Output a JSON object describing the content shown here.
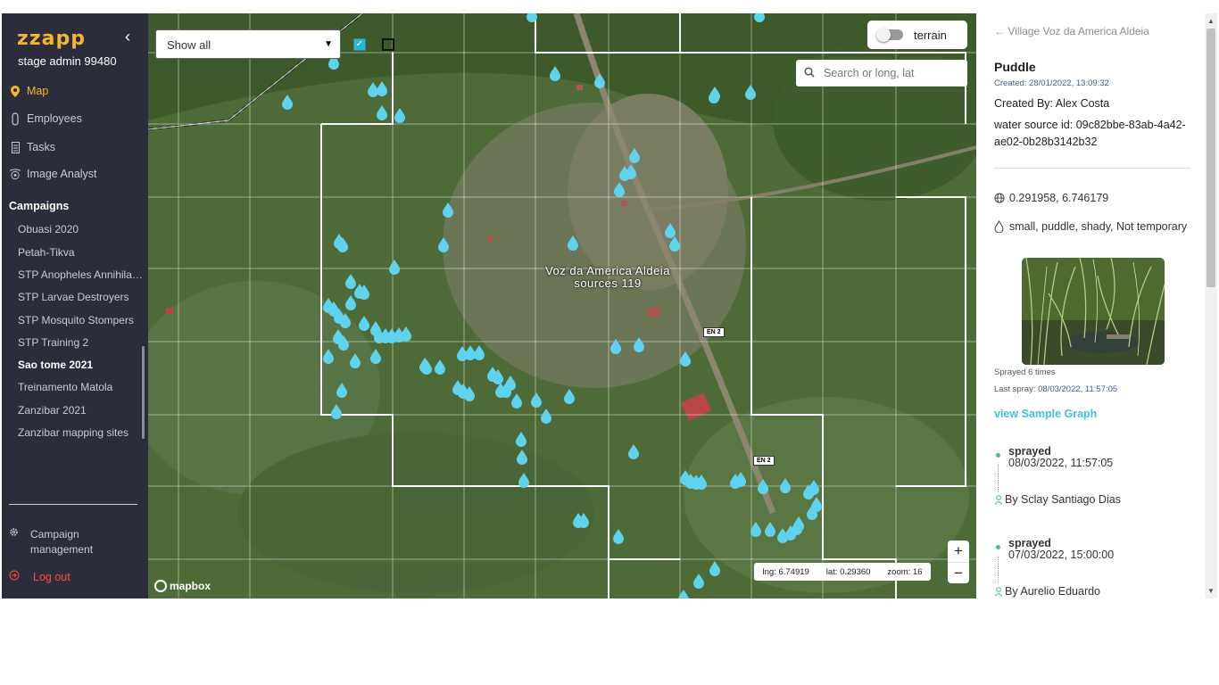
{
  "app": {
    "logo": "zzapp",
    "org": "stage admin 99480"
  },
  "nav": [
    {
      "label": "Map",
      "icon": "map-pin-icon",
      "active": true
    },
    {
      "label": "Employees",
      "icon": "employee-icon",
      "active": false
    },
    {
      "label": "Tasks",
      "icon": "tasks-icon",
      "active": false
    },
    {
      "label": "Image Analyst",
      "icon": "image-analyst-icon",
      "active": false
    }
  ],
  "campaigns": {
    "title": "Campaigns",
    "items": [
      "Obuasi 2020",
      "Petah-Tikva",
      "STP Anopheles Annihilat...",
      "STP Larvae Destroyers",
      "STP Mosquito Stompers",
      "STP Training 2",
      "Sao tome 2021",
      "Treinamento Matola",
      "Zanzibar 2021",
      "Zanzibar mapping sites"
    ],
    "selected": "Sao tome 2021"
  },
  "footer": {
    "campaign_management": "Campaign management",
    "logout": "Log out"
  },
  "map": {
    "filter": "Show all",
    "terrain_label": "terrain",
    "search_placeholder": "Search or long, lat",
    "place_label": "Voz da America Aldeia",
    "sources_label": "sources 119",
    "road_label": "EN 2",
    "lng_label": "lng:",
    "lng_value": "6.74919",
    "lat_label": "lat:",
    "lat_value": "0.29360",
    "zoom_label": "zoom:",
    "zoom_value": "16",
    "zoom_in": "+",
    "zoom_out": "−",
    "attribution": "mapbox"
  },
  "panel": {
    "back": "Village Voz da America Aldeia",
    "title": "Puddle",
    "created": "Created: 28/01/2022, 13:09:32",
    "created_by": "Created By: Alex Costa",
    "water_source": "water source id: 09c82bbe-83ab-4a42-ae02-0b28b3142b32",
    "coords": "0.291958, 6.746179",
    "tags": "small, puddle, shady, Not temporary",
    "sprayed_times": "Sprayed 6 times",
    "last_spray_label": "Last spray:",
    "last_spray_date": "08/03/2022, 11:57:05",
    "graph_link": "view Sample Graph",
    "events": [
      {
        "type": "sprayed",
        "date": "08/03/2022, 11:57:05",
        "by": "By Sclay Santiago Dias"
      },
      {
        "type": "sprayed",
        "date": "07/03/2022, 15:00:00",
        "by": "By Aurelio Eduardo"
      }
    ]
  },
  "colors": {
    "accent": "#f2b632",
    "sidebar": "#2b2d3a",
    "marker": "#5fd3ee",
    "link": "#45c0d6",
    "logout": "#ff4a4a"
  }
}
